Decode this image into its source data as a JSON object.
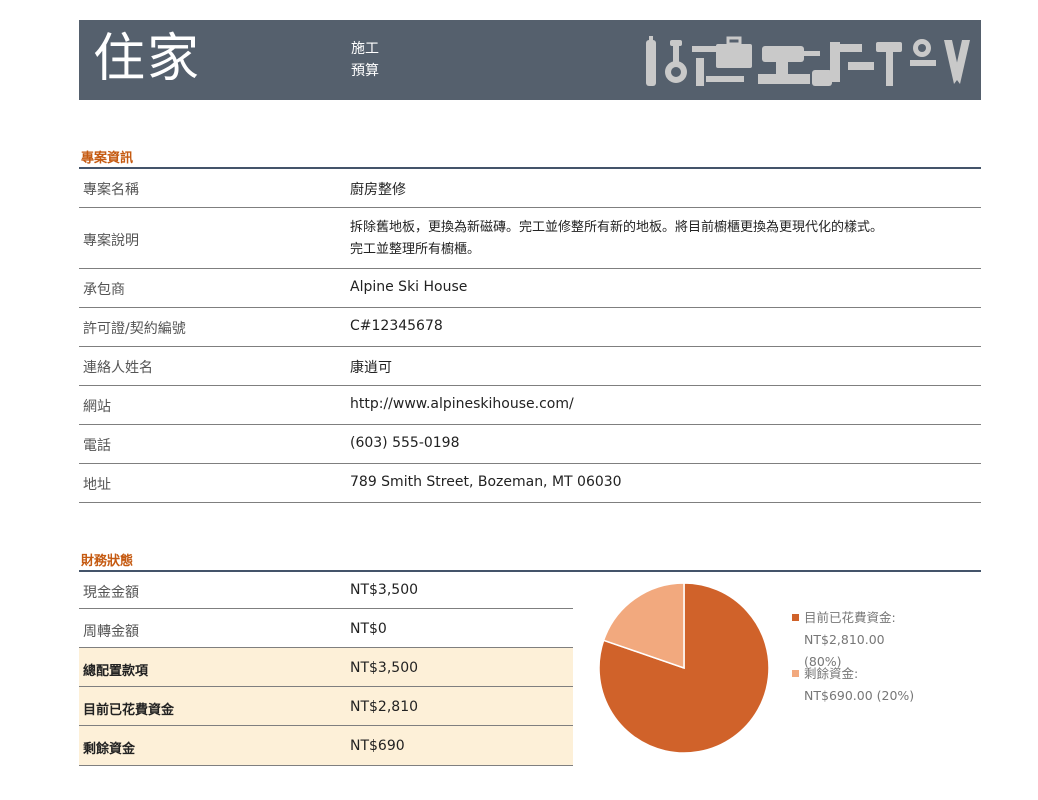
{
  "header": {
    "title": "住家",
    "subtitle_line1": "施工",
    "subtitle_line2": "預算",
    "decoration_icon": "tools-icon"
  },
  "project": {
    "section_title": "專案資訊",
    "rows": [
      {
        "label": "專案名稱",
        "value": "廚房整修"
      },
      {
        "label": "專案說明",
        "value_line1": "拆除舊地板，更換為新磁磚。完工並修整所有新的地板。將目前櫥櫃更換為更現代化的樣式。",
        "value_line2": "完工並整理所有櫥櫃。"
      },
      {
        "label": "承包商",
        "value": "Alpine Ski House"
      },
      {
        "label": "許可證/契約編號",
        "value": "C#12345678"
      },
      {
        "label": "連絡人姓名",
        "value": "康逍可"
      },
      {
        "label": "網站",
        "value": "http://www.alpineskihouse.com/"
      },
      {
        "label": "電話",
        "value": "(603) 555-0198"
      },
      {
        "label": "地址",
        "value": "789 Smith Street, Bozeman, MT 06030"
      }
    ]
  },
  "finance": {
    "section_title": "財務狀態",
    "rows": [
      {
        "label": "現金金額",
        "value": "NT$3,500"
      },
      {
        "label": "周轉金額",
        "value": "NT$0"
      },
      {
        "label": "總配置款項",
        "value": "NT$3,500"
      },
      {
        "label": "目前已花費資金",
        "value": "NT$2,810"
      },
      {
        "label": "剩餘資金",
        "value": "NT$690"
      }
    ]
  },
  "colors": {
    "banner": "#55606d",
    "accent": "#c55a11",
    "spent": "#d0622a",
    "remaining": "#f2a97e",
    "highlight_row": "#fdf0d8"
  },
  "chart_data": {
    "type": "pie",
    "categories": [
      "目前已花費資金",
      "剩餘資金"
    ],
    "values": [
      2810,
      690
    ],
    "legend": [
      {
        "name_line": "目前已花費資金:",
        "value_line": "NT$2,810.00",
        "pct_line": "(80%)"
      },
      {
        "name_line": "剩餘資金:",
        "value_line": "NT$690.00 (20%)"
      }
    ],
    "colors": [
      "#d0622a",
      "#f2a97e"
    ],
    "legend_position": "right"
  }
}
